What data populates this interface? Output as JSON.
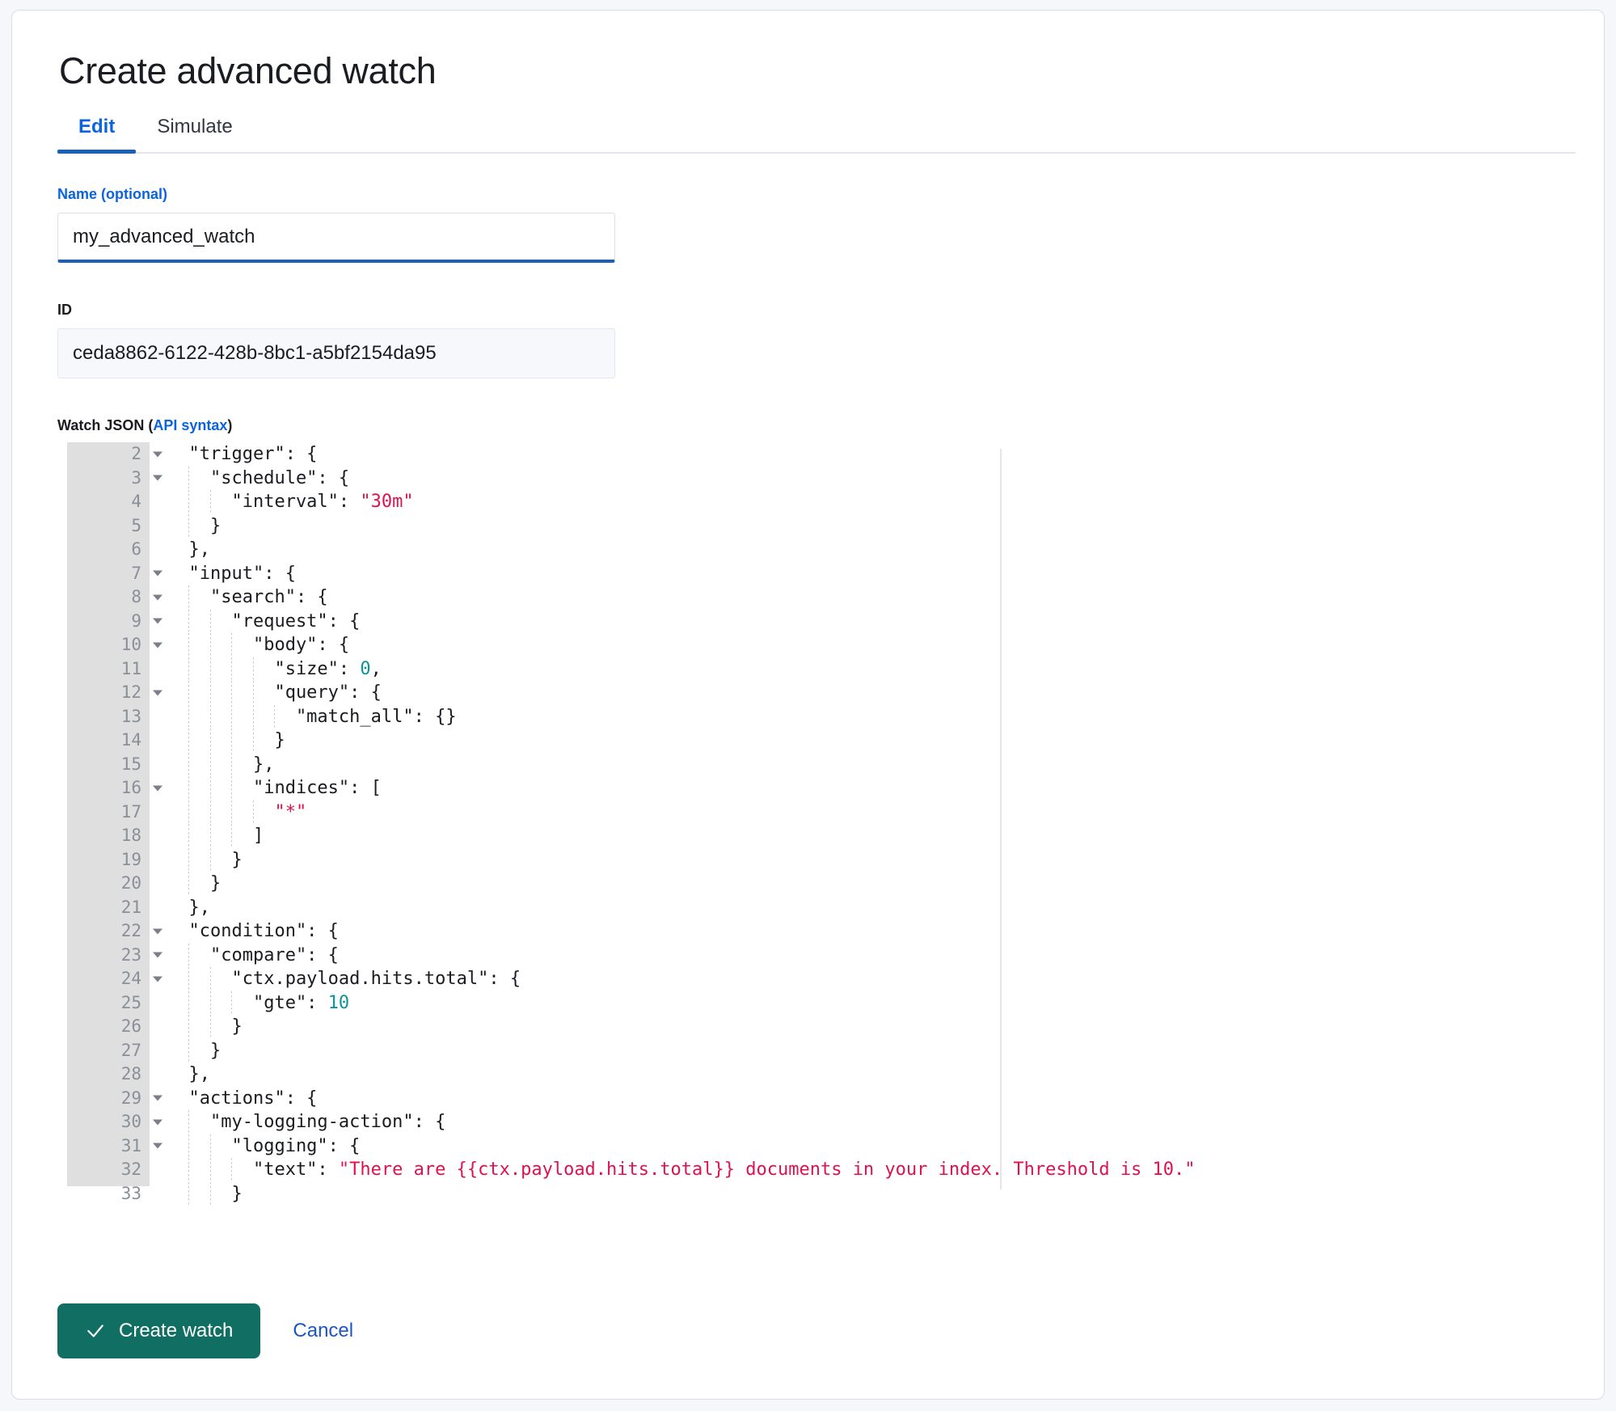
{
  "page": {
    "title": "Create advanced watch"
  },
  "tabs": [
    {
      "label": "Edit",
      "active": true
    },
    {
      "label": "Simulate",
      "active": false
    }
  ],
  "form": {
    "name": {
      "label": "Name (optional)",
      "value": "my_advanced_watch",
      "placeholder": ""
    },
    "id": {
      "label": "ID",
      "value": "ceda8862-6122-428b-8bc1-a5bf2154da95"
    }
  },
  "editor": {
    "label_prefix": "Watch JSON (",
    "label_link": "API syntax",
    "label_suffix": ")",
    "first_visible_line": 2,
    "lines": [
      {
        "n": 2,
        "fold": true,
        "text": "  \"trigger\": {"
      },
      {
        "n": 3,
        "fold": true,
        "text": "    \"schedule\": {"
      },
      {
        "n": 4,
        "fold": false,
        "text": "      \"interval\": \"30m\""
      },
      {
        "n": 5,
        "fold": false,
        "text": "    }"
      },
      {
        "n": 6,
        "fold": false,
        "text": "  },"
      },
      {
        "n": 7,
        "fold": true,
        "text": "  \"input\": {"
      },
      {
        "n": 8,
        "fold": true,
        "text": "    \"search\": {"
      },
      {
        "n": 9,
        "fold": true,
        "text": "      \"request\": {"
      },
      {
        "n": 10,
        "fold": true,
        "text": "        \"body\": {"
      },
      {
        "n": 11,
        "fold": false,
        "text": "          \"size\": 0,"
      },
      {
        "n": 12,
        "fold": true,
        "text": "          \"query\": {"
      },
      {
        "n": 13,
        "fold": false,
        "text": "            \"match_all\": {}"
      },
      {
        "n": 14,
        "fold": false,
        "text": "          }"
      },
      {
        "n": 15,
        "fold": false,
        "text": "        },"
      },
      {
        "n": 16,
        "fold": true,
        "text": "        \"indices\": ["
      },
      {
        "n": 17,
        "fold": false,
        "text": "          \"*\""
      },
      {
        "n": 18,
        "fold": false,
        "text": "        ]"
      },
      {
        "n": 19,
        "fold": false,
        "text": "      }"
      },
      {
        "n": 20,
        "fold": false,
        "text": "    }"
      },
      {
        "n": 21,
        "fold": false,
        "text": "  },"
      },
      {
        "n": 22,
        "fold": true,
        "text": "  \"condition\": {"
      },
      {
        "n": 23,
        "fold": true,
        "text": "    \"compare\": {"
      },
      {
        "n": 24,
        "fold": true,
        "text": "      \"ctx.payload.hits.total\": {"
      },
      {
        "n": 25,
        "fold": false,
        "text": "        \"gte\": 10"
      },
      {
        "n": 26,
        "fold": false,
        "text": "      }"
      },
      {
        "n": 27,
        "fold": false,
        "text": "    }"
      },
      {
        "n": 28,
        "fold": false,
        "text": "  },"
      },
      {
        "n": 29,
        "fold": true,
        "text": "  \"actions\": {"
      },
      {
        "n": 30,
        "fold": true,
        "text": "    \"my-logging-action\": {"
      },
      {
        "n": 31,
        "fold": true,
        "text": "      \"logging\": {"
      },
      {
        "n": 32,
        "fold": false,
        "text": "        \"text\": \"There are {{ctx.payload.hits.total}} documents in your index. Threshold is 10.\""
      },
      {
        "n": 33,
        "fold": false,
        "text": "      }"
      }
    ],
    "colors": {
      "string": "#E0114E",
      "number": "#0F9496",
      "text": "#1A1C21",
      "gutter_bg": "#DFDFDF",
      "line_number": "#8A8F98"
    }
  },
  "footer": {
    "create_label": "Create watch",
    "cancel_label": "Cancel",
    "create_icon": "check-icon",
    "create_color": "#106E62",
    "cancel_color": "#1A57C4"
  }
}
